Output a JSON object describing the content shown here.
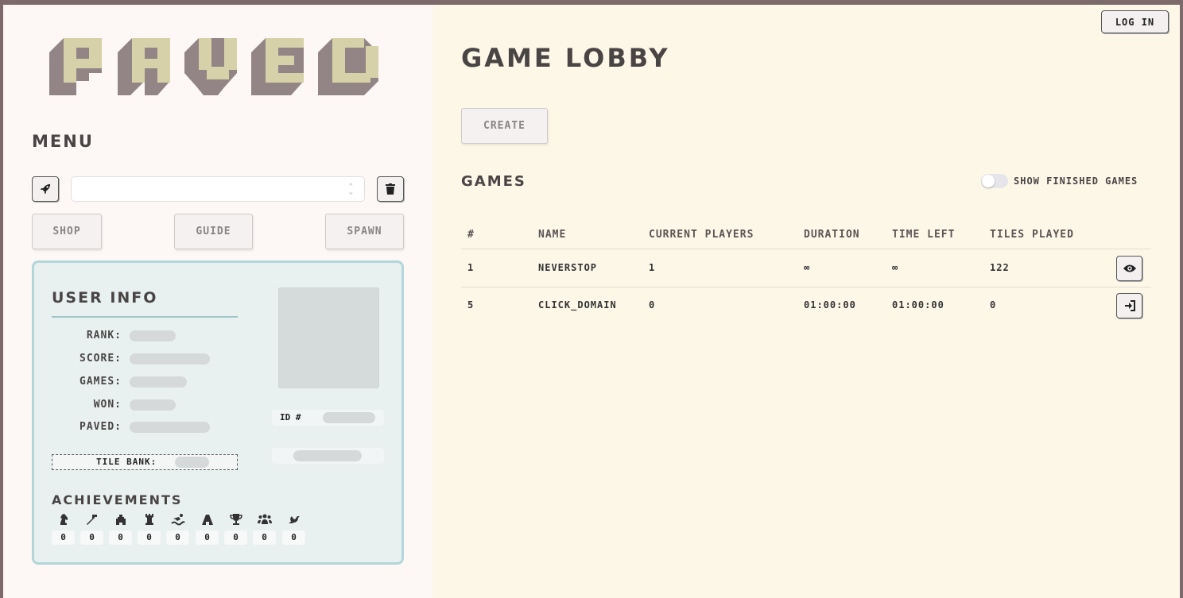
{
  "logo": {
    "text": "PAVED"
  },
  "menu": {
    "title": "MENU",
    "selected_game": "",
    "buttons": {
      "shop": "SHOP",
      "guide": "GUIDE",
      "spawn": "SPAWN"
    }
  },
  "user_info": {
    "title": "USER INFO",
    "stats": [
      {
        "label": "RANK:"
      },
      {
        "label": "SCORE:"
      },
      {
        "label": "GAMES:"
      },
      {
        "label": "WON:"
      },
      {
        "label": "PAVED:"
      }
    ],
    "id_label": "ID #",
    "tile_bank_label": "TILE BANK:",
    "achievements_title": "ACHIEVEMENTS",
    "achievements": [
      {
        "icon": "chess-knight-icon",
        "count": "0"
      },
      {
        "icon": "hammer-icon",
        "count": "0"
      },
      {
        "icon": "castle-icon",
        "count": "0"
      },
      {
        "icon": "chess-rook-icon",
        "count": "0"
      },
      {
        "icon": "water-swimmer-icon",
        "count": "0"
      },
      {
        "icon": "road-icon",
        "count": "0"
      },
      {
        "icon": "trophy-icon",
        "count": "0"
      },
      {
        "icon": "people-group-icon",
        "count": "0"
      },
      {
        "icon": "dove-icon",
        "count": "0"
      }
    ]
  },
  "header": {
    "login": "LOG IN"
  },
  "lobby": {
    "title": "GAME LOBBY",
    "create": "CREATE",
    "games_title": "GAMES",
    "show_finished_label": "SHOW FINISHED GAMES",
    "show_finished": false,
    "columns": [
      "#",
      "NAME",
      "CURRENT PLAYERS",
      "DURATION",
      "TIME LEFT",
      "TILES PLAYED"
    ],
    "rows": [
      {
        "id": "1",
        "name": "NEVERSTOP",
        "players": "1",
        "duration": "∞",
        "time_left": "∞",
        "tiles": "122",
        "action": "eye-icon"
      },
      {
        "id": "5",
        "name": "CLICK_DOMAIN",
        "players": "0",
        "duration": "01:00:00",
        "time_left": "01:00:00",
        "tiles": "0",
        "action": "sign-in-icon"
      }
    ]
  },
  "colors": {
    "logo_face": "#d6d1a8",
    "logo_side": "#938585",
    "panel_border": "#b3d6d8",
    "left_bg": "#fdf7f6",
    "right_bg": "#fdf7e8"
  }
}
